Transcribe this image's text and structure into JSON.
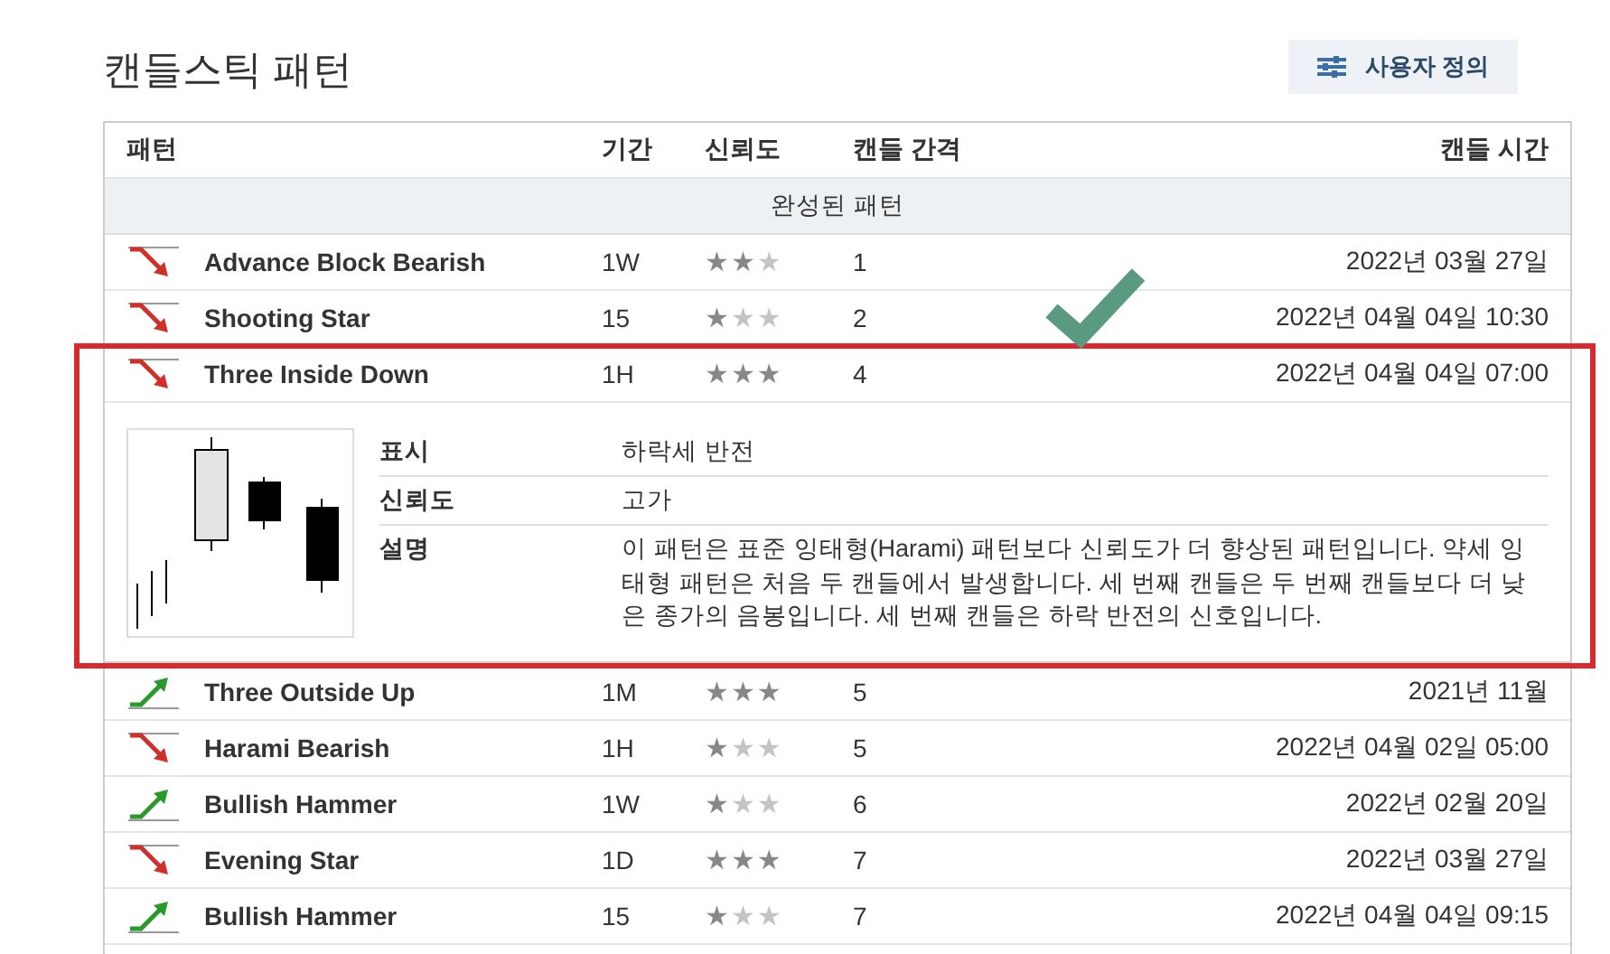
{
  "title": "캔들스틱 패턴",
  "custom_button": {
    "label": "사용자 정의"
  },
  "table": {
    "columns": [
      "패턴",
      "기간",
      "신뢰도",
      "캔들 간격",
      "캔들 시간"
    ],
    "group_label": "완성된 패턴",
    "rows": [
      {
        "kind": "bearish",
        "name": "Advance Block Bearish",
        "period": "1W",
        "stars": 2,
        "interval": "1",
        "time": "2022년 03월 27일",
        "expanded": false
      },
      {
        "kind": "bearish",
        "name": "Shooting Star",
        "period": "15",
        "stars": 1,
        "interval": "2",
        "time": "2022년 04월 04일 10:30",
        "expanded": false
      },
      {
        "kind": "bearish",
        "name": "Three Inside Down",
        "period": "1H",
        "stars": 3,
        "interval": "4",
        "time": "2022년 04월 04일 07:00",
        "expanded": true,
        "detail": [
          {
            "label": "표시",
            "value": "하락세 반전"
          },
          {
            "label": "신뢰도",
            "value": "고가"
          },
          {
            "label": "설명",
            "value": "이 패턴은 표준 잉태형(Harami) 패턴보다 신뢰도가 더 향상된 패턴입니다. 약세 잉태형 패턴은 처음 두 캔들에서 발생합니다. 세 번째 캔들은 두 번째 캔들보다 더 낮은 종가의 음봉입니다. 세 번째 캔들은 하락 반전의 신호입니다."
          }
        ]
      },
      {
        "kind": "bullish",
        "name": "Three Outside Up",
        "period": "1M",
        "stars": 3,
        "interval": "5",
        "time": "2021년 11월",
        "expanded": false
      },
      {
        "kind": "bearish",
        "name": "Harami Bearish",
        "period": "1H",
        "stars": 1,
        "interval": "5",
        "time": "2022년 04월 02일 05:00",
        "expanded": false
      },
      {
        "kind": "bullish",
        "name": "Bullish Hammer",
        "period": "1W",
        "stars": 1,
        "interval": "6",
        "time": "2022년 02월 20일",
        "expanded": false
      },
      {
        "kind": "bearish",
        "name": "Evening Star",
        "period": "1D",
        "stars": 3,
        "interval": "7",
        "time": "2022년 03월 27일",
        "expanded": false
      },
      {
        "kind": "bullish",
        "name": "Bullish Hammer",
        "period": "15",
        "stars": 1,
        "interval": "7",
        "time": "2022년 04월 04일 09:15",
        "expanded": false
      }
    ]
  }
}
